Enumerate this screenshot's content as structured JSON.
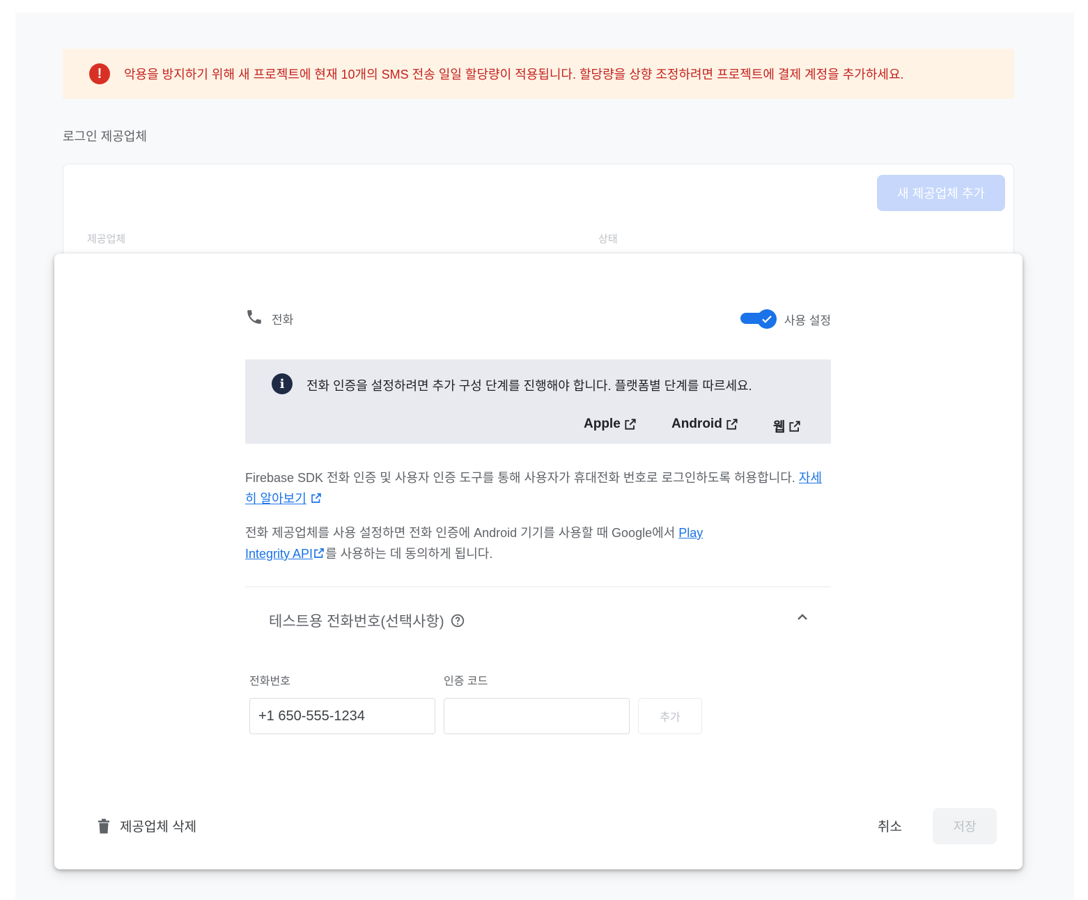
{
  "banner": {
    "text": "악용을 방지하기 위해 새 프로젝트에 현재 10개의 SMS 전송 일일 할당량이 적용됩니다. 할당량을 상향 조정하려면 프로젝트에 결제 계정을 추가하세요.",
    "icon": "error-icon"
  },
  "section": {
    "title": "로그인 제공업체"
  },
  "providers_card": {
    "add_button": "새 제공업체 추가",
    "columns": [
      "제공업체",
      "상태"
    ]
  },
  "dialog": {
    "provider_label": "전화",
    "toggle_label": "사용 설정",
    "toggle_on": true,
    "info": {
      "text": "전화 인증을 설정하려면 추가 구성 단계를 진행해야 합니다. 플랫폼별 단계를 따르세요.",
      "platforms": [
        "Apple",
        "Android",
        "웹"
      ]
    },
    "desc1": {
      "text": "Firebase SDK 전화 인증 및 사용자 인증 도구를 통해 사용자가 휴대전화 번호로 로그인하도록 허용합니다.",
      "link": "자세히 알아보기"
    },
    "desc2": {
      "text_before": "전화 제공업체를 사용 설정하면 전화 인증에 Android 기기를 사용할 때 Google에서",
      "link": "Play Integrity API",
      "text_after": "를 사용하는 데 동의하게 됩니다."
    },
    "test_numbers": {
      "title": "테스트용 전화번호(선택사항)",
      "phone_label": "전화번호",
      "code_label": "인증 코드",
      "phone_value": "+1 650-555-1234",
      "code_value": "",
      "add_button": "추가"
    },
    "footer": {
      "delete_label": "제공업체 삭제",
      "cancel_label": "취소",
      "save_label": "저장"
    }
  }
}
